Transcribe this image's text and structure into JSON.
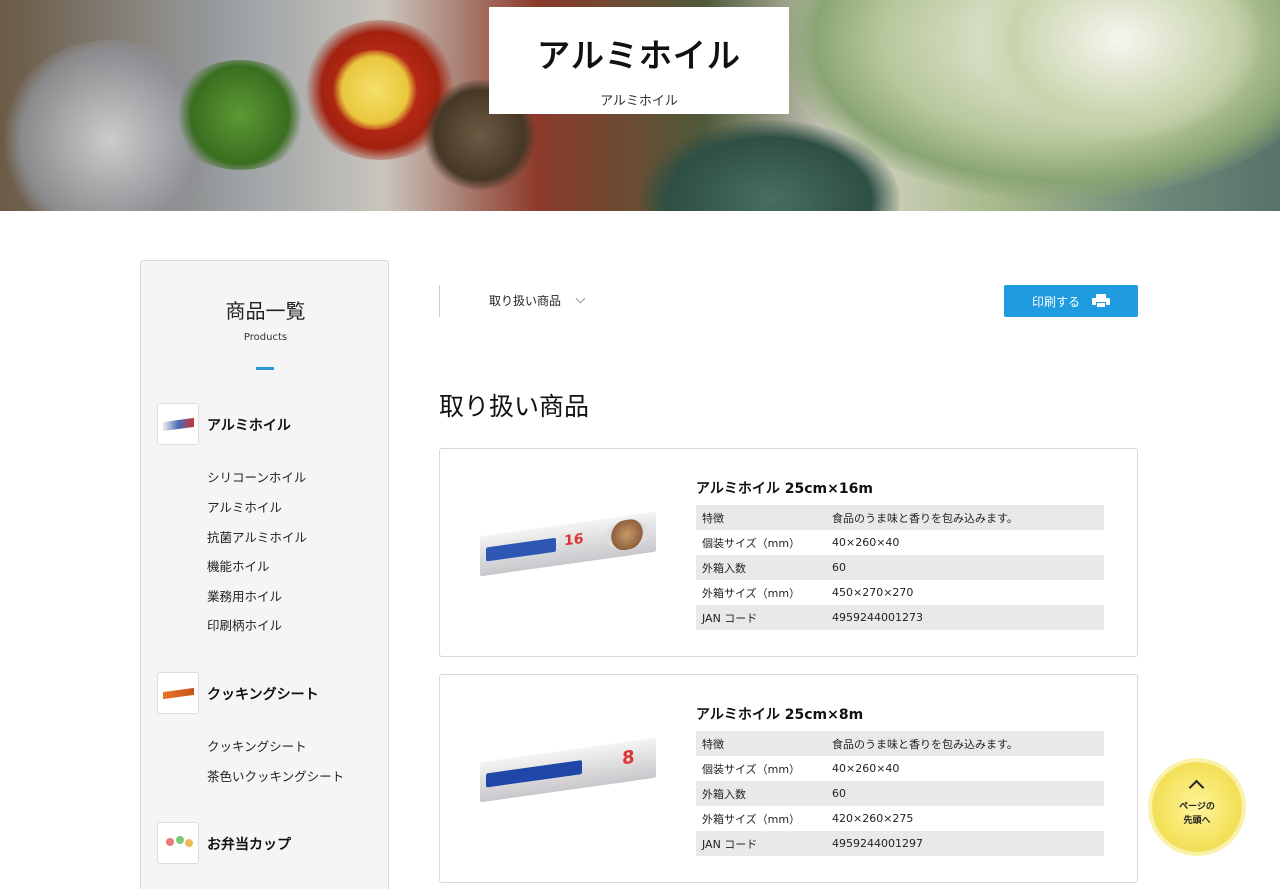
{
  "hero": {
    "title": "アルミホイル",
    "subtitle": "アルミホイル"
  },
  "sidebar": {
    "title": "商品一覧",
    "subtitle": "Products",
    "categories": [
      {
        "label": "アルミホイル",
        "items": [
          "シリコーンホイル",
          "アルミホイル",
          "抗菌アルミホイル",
          "機能ホイル",
          "業務用ホイル",
          "印刷柄ホイル"
        ]
      },
      {
        "label": "クッキングシート",
        "items": [
          "クッキングシート",
          "茶色いクッキングシート"
        ]
      },
      {
        "label": "お弁当カップ",
        "items": []
      }
    ]
  },
  "toolbar": {
    "dropdown_label": "取り扱い商品",
    "print_label": "印刷する"
  },
  "section_title": "取り扱い商品",
  "products": [
    {
      "name": "アルミホイル 25cm×16m",
      "box_text": "16",
      "specs": [
        {
          "key": "特徴",
          "value": "食品のうま味と香りを包み込みます。"
        },
        {
          "key": "個装サイズ（mm）",
          "value": "40×260×40"
        },
        {
          "key": "外箱入数",
          "value": "60"
        },
        {
          "key": "外箱サイズ（mm）",
          "value": "450×270×270"
        },
        {
          "key": "JAN コード",
          "value": "4959244001273"
        }
      ]
    },
    {
      "name": "アルミホイル 25cm×8m",
      "box_text": "8",
      "specs": [
        {
          "key": "特徴",
          "value": "食品のうま味と香りを包み込みます。"
        },
        {
          "key": "個装サイズ（mm）",
          "value": "40×260×40"
        },
        {
          "key": "外箱入数",
          "value": "60"
        },
        {
          "key": "外箱サイズ（mm）",
          "value": "420×260×275"
        },
        {
          "key": "JAN コード",
          "value": "4959244001297"
        }
      ]
    }
  ],
  "back_to_top": {
    "line1": "ページの",
    "line2": "先頭へ"
  },
  "colors": {
    "accent": "#1f9be0",
    "sidebar_bg": "#f5f5f5",
    "spec_row_bg": "#e9e9e9"
  }
}
